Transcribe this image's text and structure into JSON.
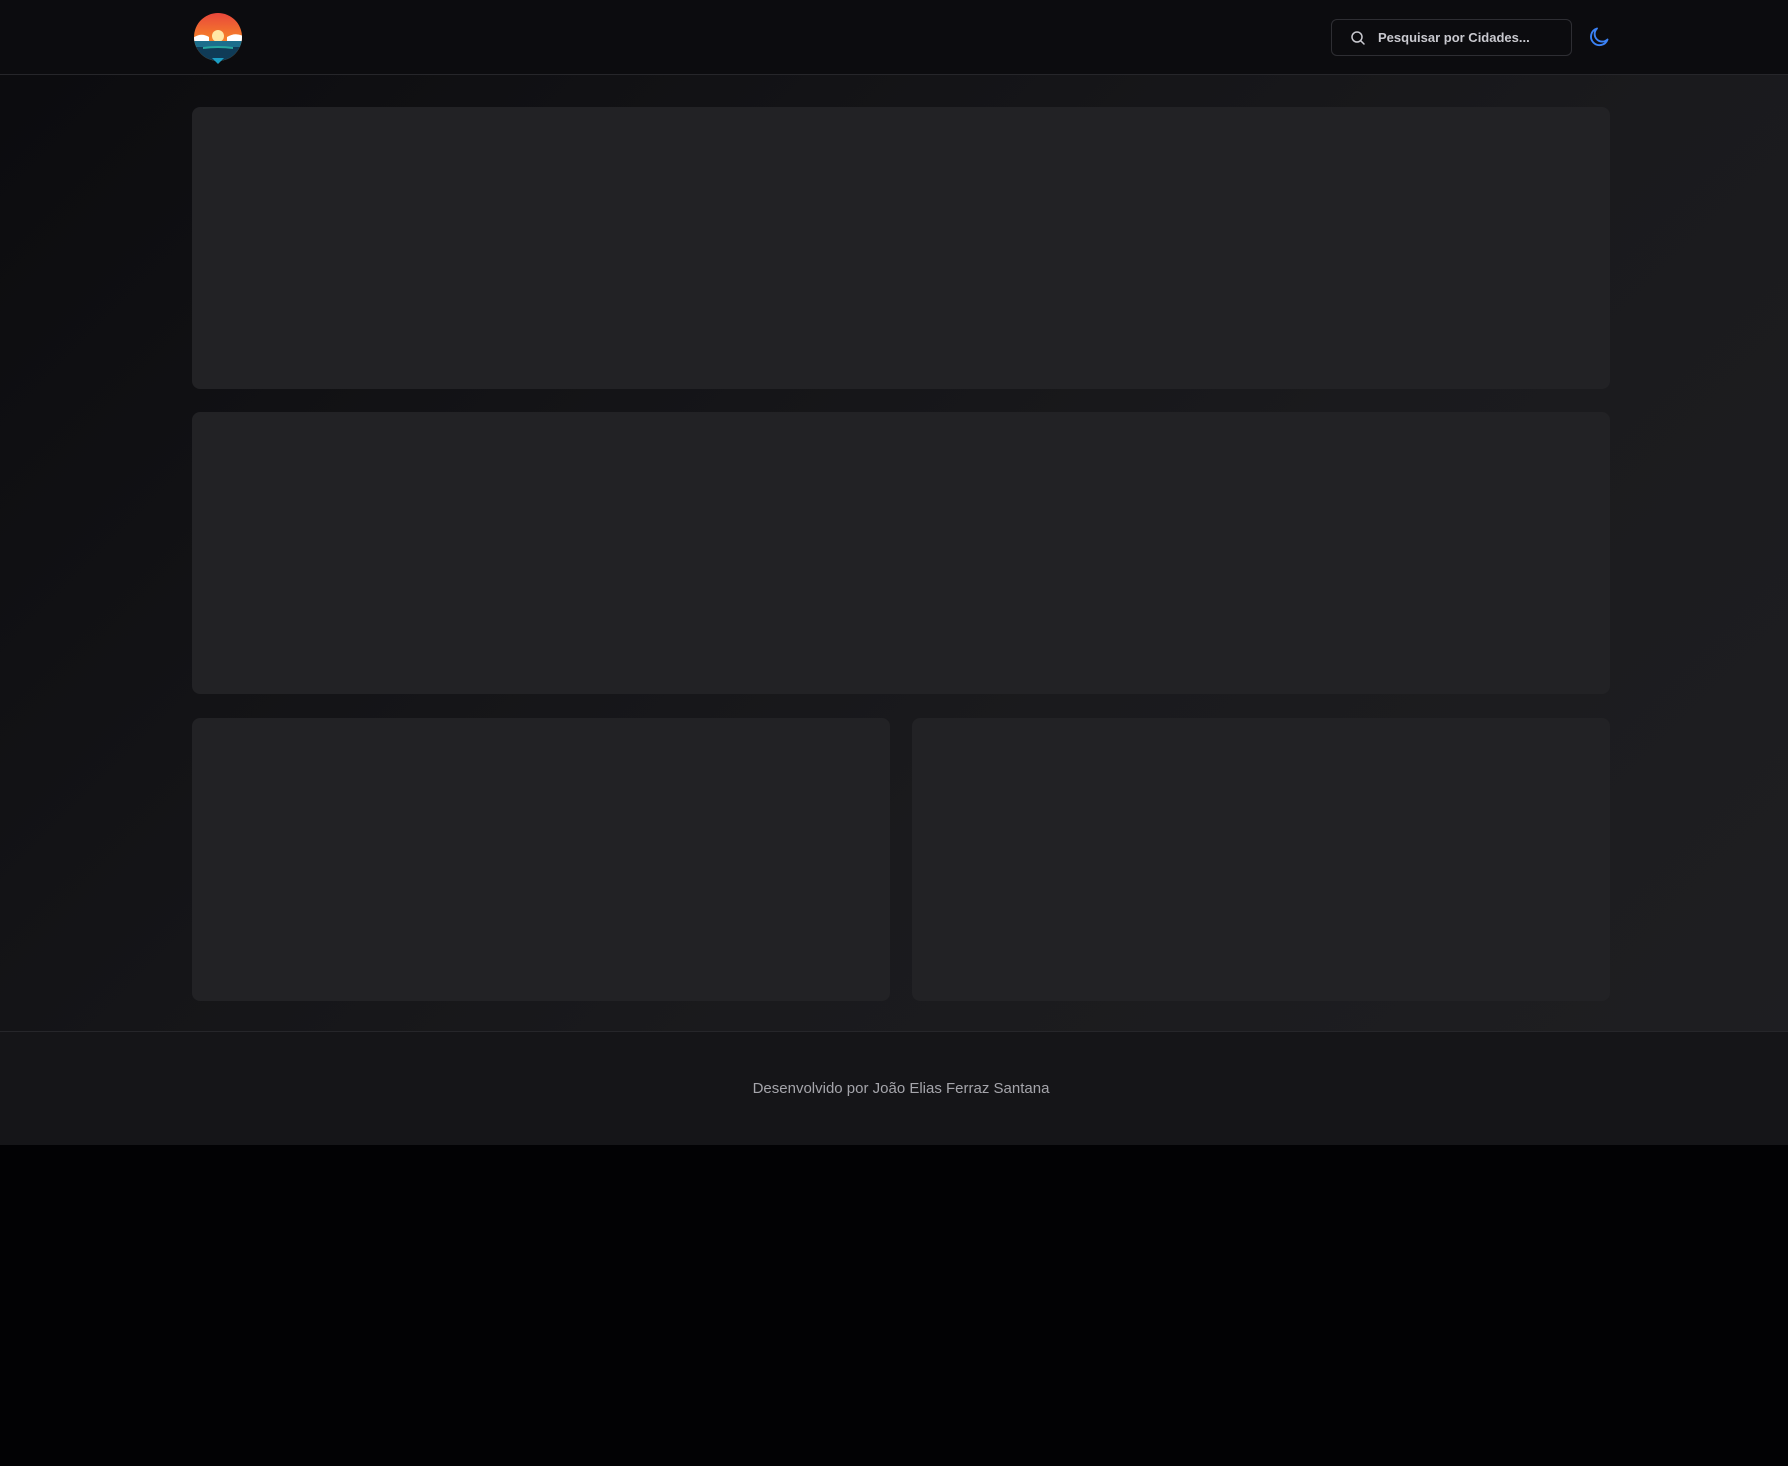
{
  "header": {
    "search": {
      "placeholder": "Pesquisar por Cidades..."
    },
    "icons": {
      "logo": "sunset-pin-logo",
      "search": "search-icon",
      "theme": "moon-icon"
    }
  },
  "footer": {
    "credit": "Desenvolvido por João Elias Ferraz Santana"
  },
  "colors": {
    "background": "#141417",
    "card": "#222225",
    "accent": "#3b82f6",
    "footer_text": "#a5a5ab"
  }
}
